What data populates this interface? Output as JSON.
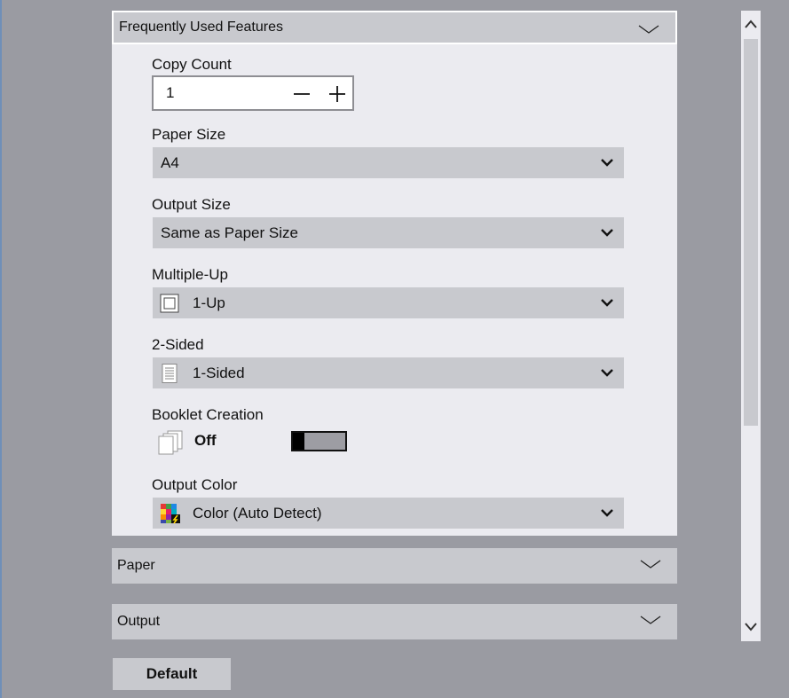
{
  "sections": {
    "frequently_used": {
      "title": "Frequently Used Features"
    },
    "paper": {
      "title": "Paper"
    },
    "output": {
      "title": "Output"
    }
  },
  "copy_count": {
    "label": "Copy Count",
    "value": "1"
  },
  "paper_size": {
    "label": "Paper Size",
    "value": "A4"
  },
  "output_size": {
    "label": "Output Size",
    "value": "Same as Paper Size"
  },
  "multiple_up": {
    "label": "Multiple-Up",
    "value": "1-Up",
    "icon": "single-page-icon"
  },
  "two_sided": {
    "label": "2-Sided",
    "value": "1-Sided",
    "icon": "one-sided-page-icon"
  },
  "booklet": {
    "label": "Booklet Creation",
    "value": "Off",
    "icon": "booklet-stack-icon",
    "toggle_on": false
  },
  "output_color": {
    "label": "Output Color",
    "value": "Color (Auto Detect)",
    "icon": "color-auto-detect-icon"
  },
  "footer": {
    "default_label": "Default"
  },
  "colors": {
    "background": "#9a9ba2",
    "panel": "#ebebf0",
    "control": "#c8c9ce"
  }
}
